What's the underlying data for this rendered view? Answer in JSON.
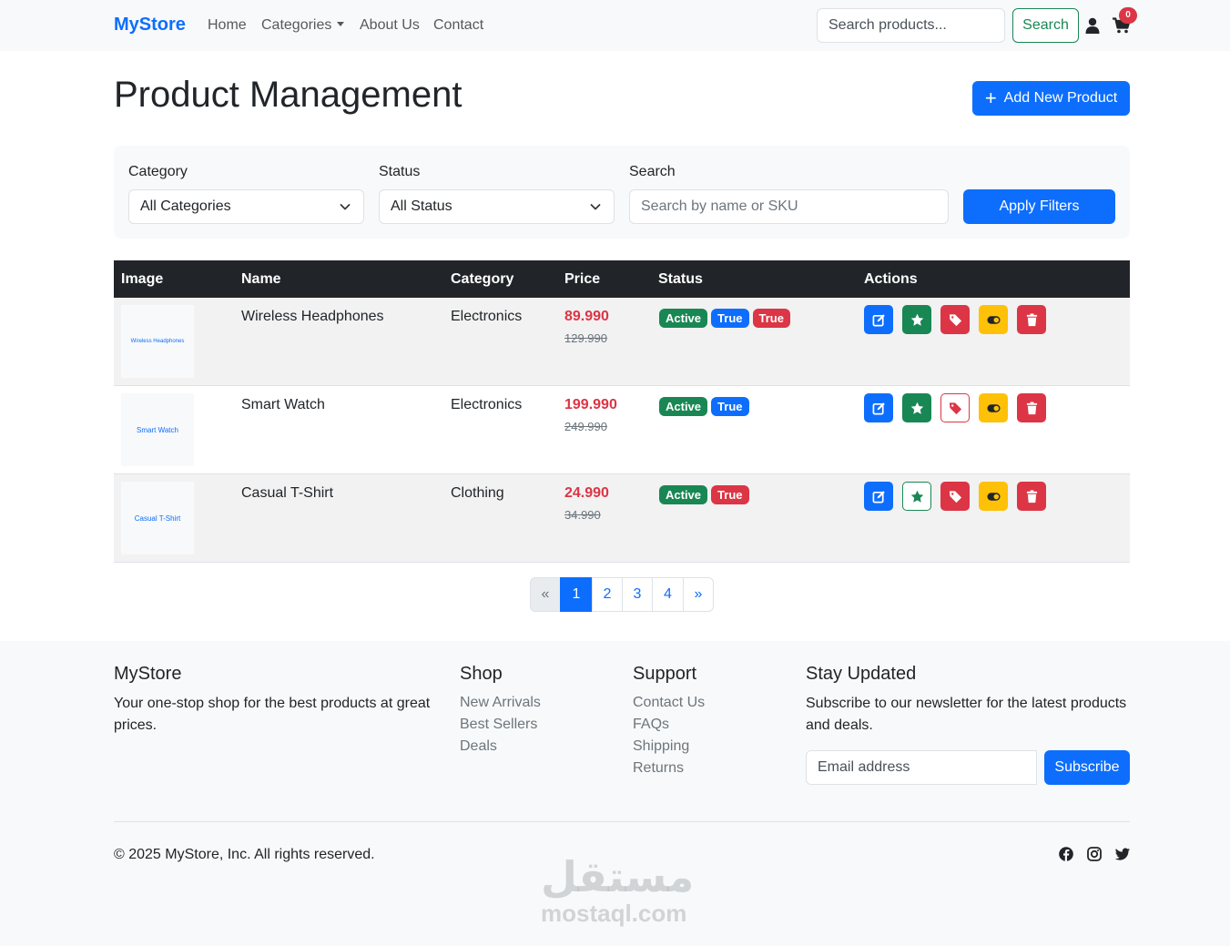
{
  "navbar": {
    "brand": "MyStore",
    "links": [
      "Home",
      "Categories",
      "About Us",
      "Contact"
    ],
    "search_placeholder": "Search products...",
    "search_button": "Search",
    "cart_count": "0"
  },
  "header": {
    "title": "Product Management",
    "add_button": "Add New Product"
  },
  "filters": {
    "category_label": "Category",
    "category_value": "All Categories",
    "status_label": "Status",
    "status_value": "All Status",
    "search_label": "Search",
    "search_placeholder": "Search by name or SKU",
    "apply_button": "Apply Filters"
  },
  "table": {
    "headers": [
      "Image",
      "Name",
      "Category",
      "Price",
      "Status",
      "Actions"
    ],
    "rows": [
      {
        "thumb": "Wireless Headphones",
        "name": "Wireless Headphones",
        "category": "Electronics",
        "price": "89.990",
        "old_price": "129.990",
        "badges": [
          "Active",
          "True",
          "True"
        ]
      },
      {
        "thumb": "Smart Watch",
        "name": "Smart Watch",
        "category": "Electronics",
        "price": "199.990",
        "old_price": "249.990",
        "badges": [
          "Active",
          "True"
        ]
      },
      {
        "thumb": "Casual T-Shirt",
        "name": "Casual T-Shirt",
        "category": "Clothing",
        "price": "24.990",
        "old_price": "34.990",
        "badges": [
          "Active",
          "True"
        ]
      }
    ]
  },
  "pagination": {
    "prev": "«",
    "pages": [
      "1",
      "2",
      "3",
      "4"
    ],
    "next": "»",
    "active_page": "1"
  },
  "footer": {
    "about_title": "MyStore",
    "about_text": "Your one-stop shop for the best products at great prices.",
    "shop_title": "Shop",
    "shop_links": [
      "New Arrivals",
      "Best Sellers",
      "Deals"
    ],
    "support_title": "Support",
    "support_links": [
      "Contact Us",
      "FAQs",
      "Shipping",
      "Returns"
    ],
    "news_title": "Stay Updated",
    "news_text": "Subscribe to our newsletter for the latest products and deals.",
    "email_placeholder": "Email address",
    "subscribe_button": "Subscribe",
    "copyright": "© 2025 MyStore, Inc. All rights reserved."
  },
  "watermark": {
    "arabic": "مستقل",
    "latin": "mostaql.com"
  },
  "colors": {
    "primary": "#0d6efd",
    "success": "#198754",
    "danger": "#dc3545",
    "warning": "#ffc107",
    "dark": "#212529"
  }
}
